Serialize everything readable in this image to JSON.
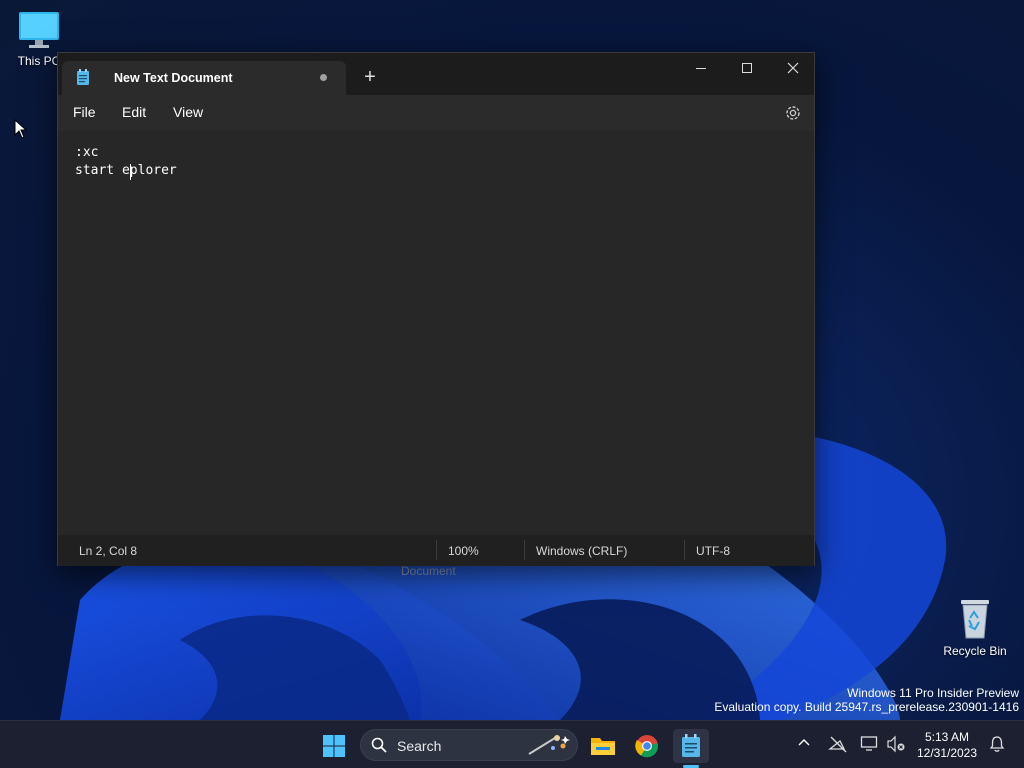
{
  "desktop": {
    "icons": [
      {
        "label": "This PC",
        "icon": "monitor-icon"
      },
      {
        "label": "Recycle Bin",
        "icon": "recycle-bin-icon"
      }
    ],
    "background_label": "Document",
    "watermark": {
      "line1": "Windows 11 Pro Insider Preview",
      "line2": "Evaluation copy. Build 25947.rs_prerelease.230901-1416"
    }
  },
  "notepad": {
    "tab_title": "New Text Document",
    "tab_unsaved_indicator": "dot",
    "new_tab_label": "+",
    "menu": [
      "File",
      "Edit",
      "View"
    ],
    "editor_lines": [
      ":xc",
      "start eplorer"
    ],
    "status": {
      "position": "Ln 2, Col 8",
      "zoom": "100%",
      "line_ending": "Windows (CRLF)",
      "encoding": "UTF-8"
    }
  },
  "taskbar": {
    "search_placeholder": "Search",
    "pinned": [
      "start-icon",
      "file-explorer-icon",
      "chrome-icon",
      "notepad-icon"
    ],
    "active_app": "notepad-icon",
    "clock": {
      "time": "5:13 AM",
      "date": "12/31/2023"
    }
  },
  "colors": {
    "window_bg": "#202020",
    "editor_bg": "#272727",
    "accent": "#4cc2ff",
    "taskbar_bg": "#1c2030"
  }
}
